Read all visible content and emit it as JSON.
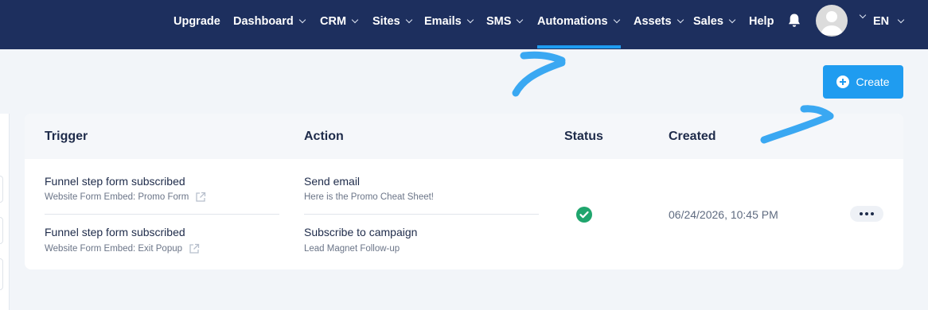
{
  "nav": {
    "items": [
      {
        "label": "Upgrade",
        "has_menu": false
      },
      {
        "label": "Dashboard",
        "has_menu": true
      },
      {
        "label": "CRM",
        "has_menu": true
      },
      {
        "label": "Sites",
        "has_menu": true
      },
      {
        "label": "Emails",
        "has_menu": true
      },
      {
        "label": "SMS",
        "has_menu": true
      },
      {
        "label": "Automations",
        "has_menu": true,
        "active": true
      },
      {
        "label": "Assets",
        "has_menu": true
      },
      {
        "label": "Sales",
        "has_menu": true
      },
      {
        "label": "Help",
        "has_menu": false
      }
    ],
    "language": "EN",
    "icons": {
      "notifications": "bell-icon",
      "profile": "avatar"
    }
  },
  "toolbar": {
    "create_label": "Create"
  },
  "table": {
    "headers": {
      "trigger": "Trigger",
      "action": "Action",
      "status": "Status",
      "created": "Created"
    },
    "rows": [
      {
        "triggers": [
          {
            "title": "Funnel step form subscribed",
            "source": "Website Form Embed: Promo Form"
          },
          {
            "title": "Funnel step form subscribed",
            "source": "Website Form Embed: Exit Popup"
          }
        ],
        "actions": [
          {
            "title": "Send email",
            "detail": "Here is the Promo Cheat Sheet!"
          },
          {
            "title": "Subscribe to campaign",
            "detail": "Lead Magnet Follow-up"
          }
        ],
        "status": "active",
        "created": "06/24/2026, 10:45 PM"
      }
    ]
  },
  "colors": {
    "nav_bg": "#1d2f5e",
    "accent": "#1f9cf0",
    "status_ok": "#1fa56d",
    "annotation": "#3aa8f2"
  }
}
